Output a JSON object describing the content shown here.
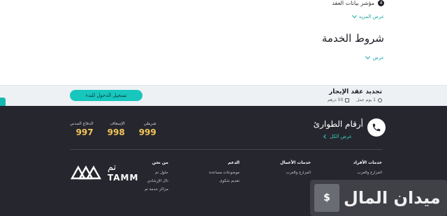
{
  "content": {
    "bullet_number": "4",
    "bullet_text": "مؤشر بيانات العقد",
    "more_link": "عرض المزيد",
    "section_title": "شروط الخدمة",
    "show_link": "عرض"
  },
  "service_bar": {
    "title": "تجديد عقد الإيجار",
    "duration": "1 يوم عمل",
    "fee": "50 درهم",
    "login_button": "تسجيل الدخول للبدء"
  },
  "footer": {
    "emergency_title": "أرقام الطوارئ",
    "view_all": "عرض الكل",
    "hotlines": [
      {
        "label": "شرطي",
        "number": "999"
      },
      {
        "label": "الإسعاف",
        "number": "998"
      },
      {
        "label": "الدفاع المدني",
        "number": "997"
      }
    ],
    "columns": [
      {
        "title": "خدمات الأفراد",
        "items": [
          "المزارع والعزب",
          "",
          "",
          ""
        ]
      },
      {
        "title": "خدمات الأعمال",
        "items": [
          "المزارع والعزب",
          "",
          "",
          ""
        ]
      },
      {
        "title": "الدعم",
        "items": [
          "موضوعات مساعدة",
          "",
          "تقديم شكوى",
          ""
        ]
      },
      {
        "title": "من نحن",
        "items": [
          "حلول تم",
          "تاک الإرشادي",
          "مراكز خدمة تم",
          ""
        ]
      }
    ],
    "logo": {
      "ar": "تم",
      "en": "TAMM"
    }
  },
  "watermark": {
    "text": "ميدان المال"
  },
  "colors": {
    "accent": "#17c7bd",
    "footer_bg": "#26272e",
    "hotline": "#f4c55a",
    "link": "#17a3a5"
  }
}
